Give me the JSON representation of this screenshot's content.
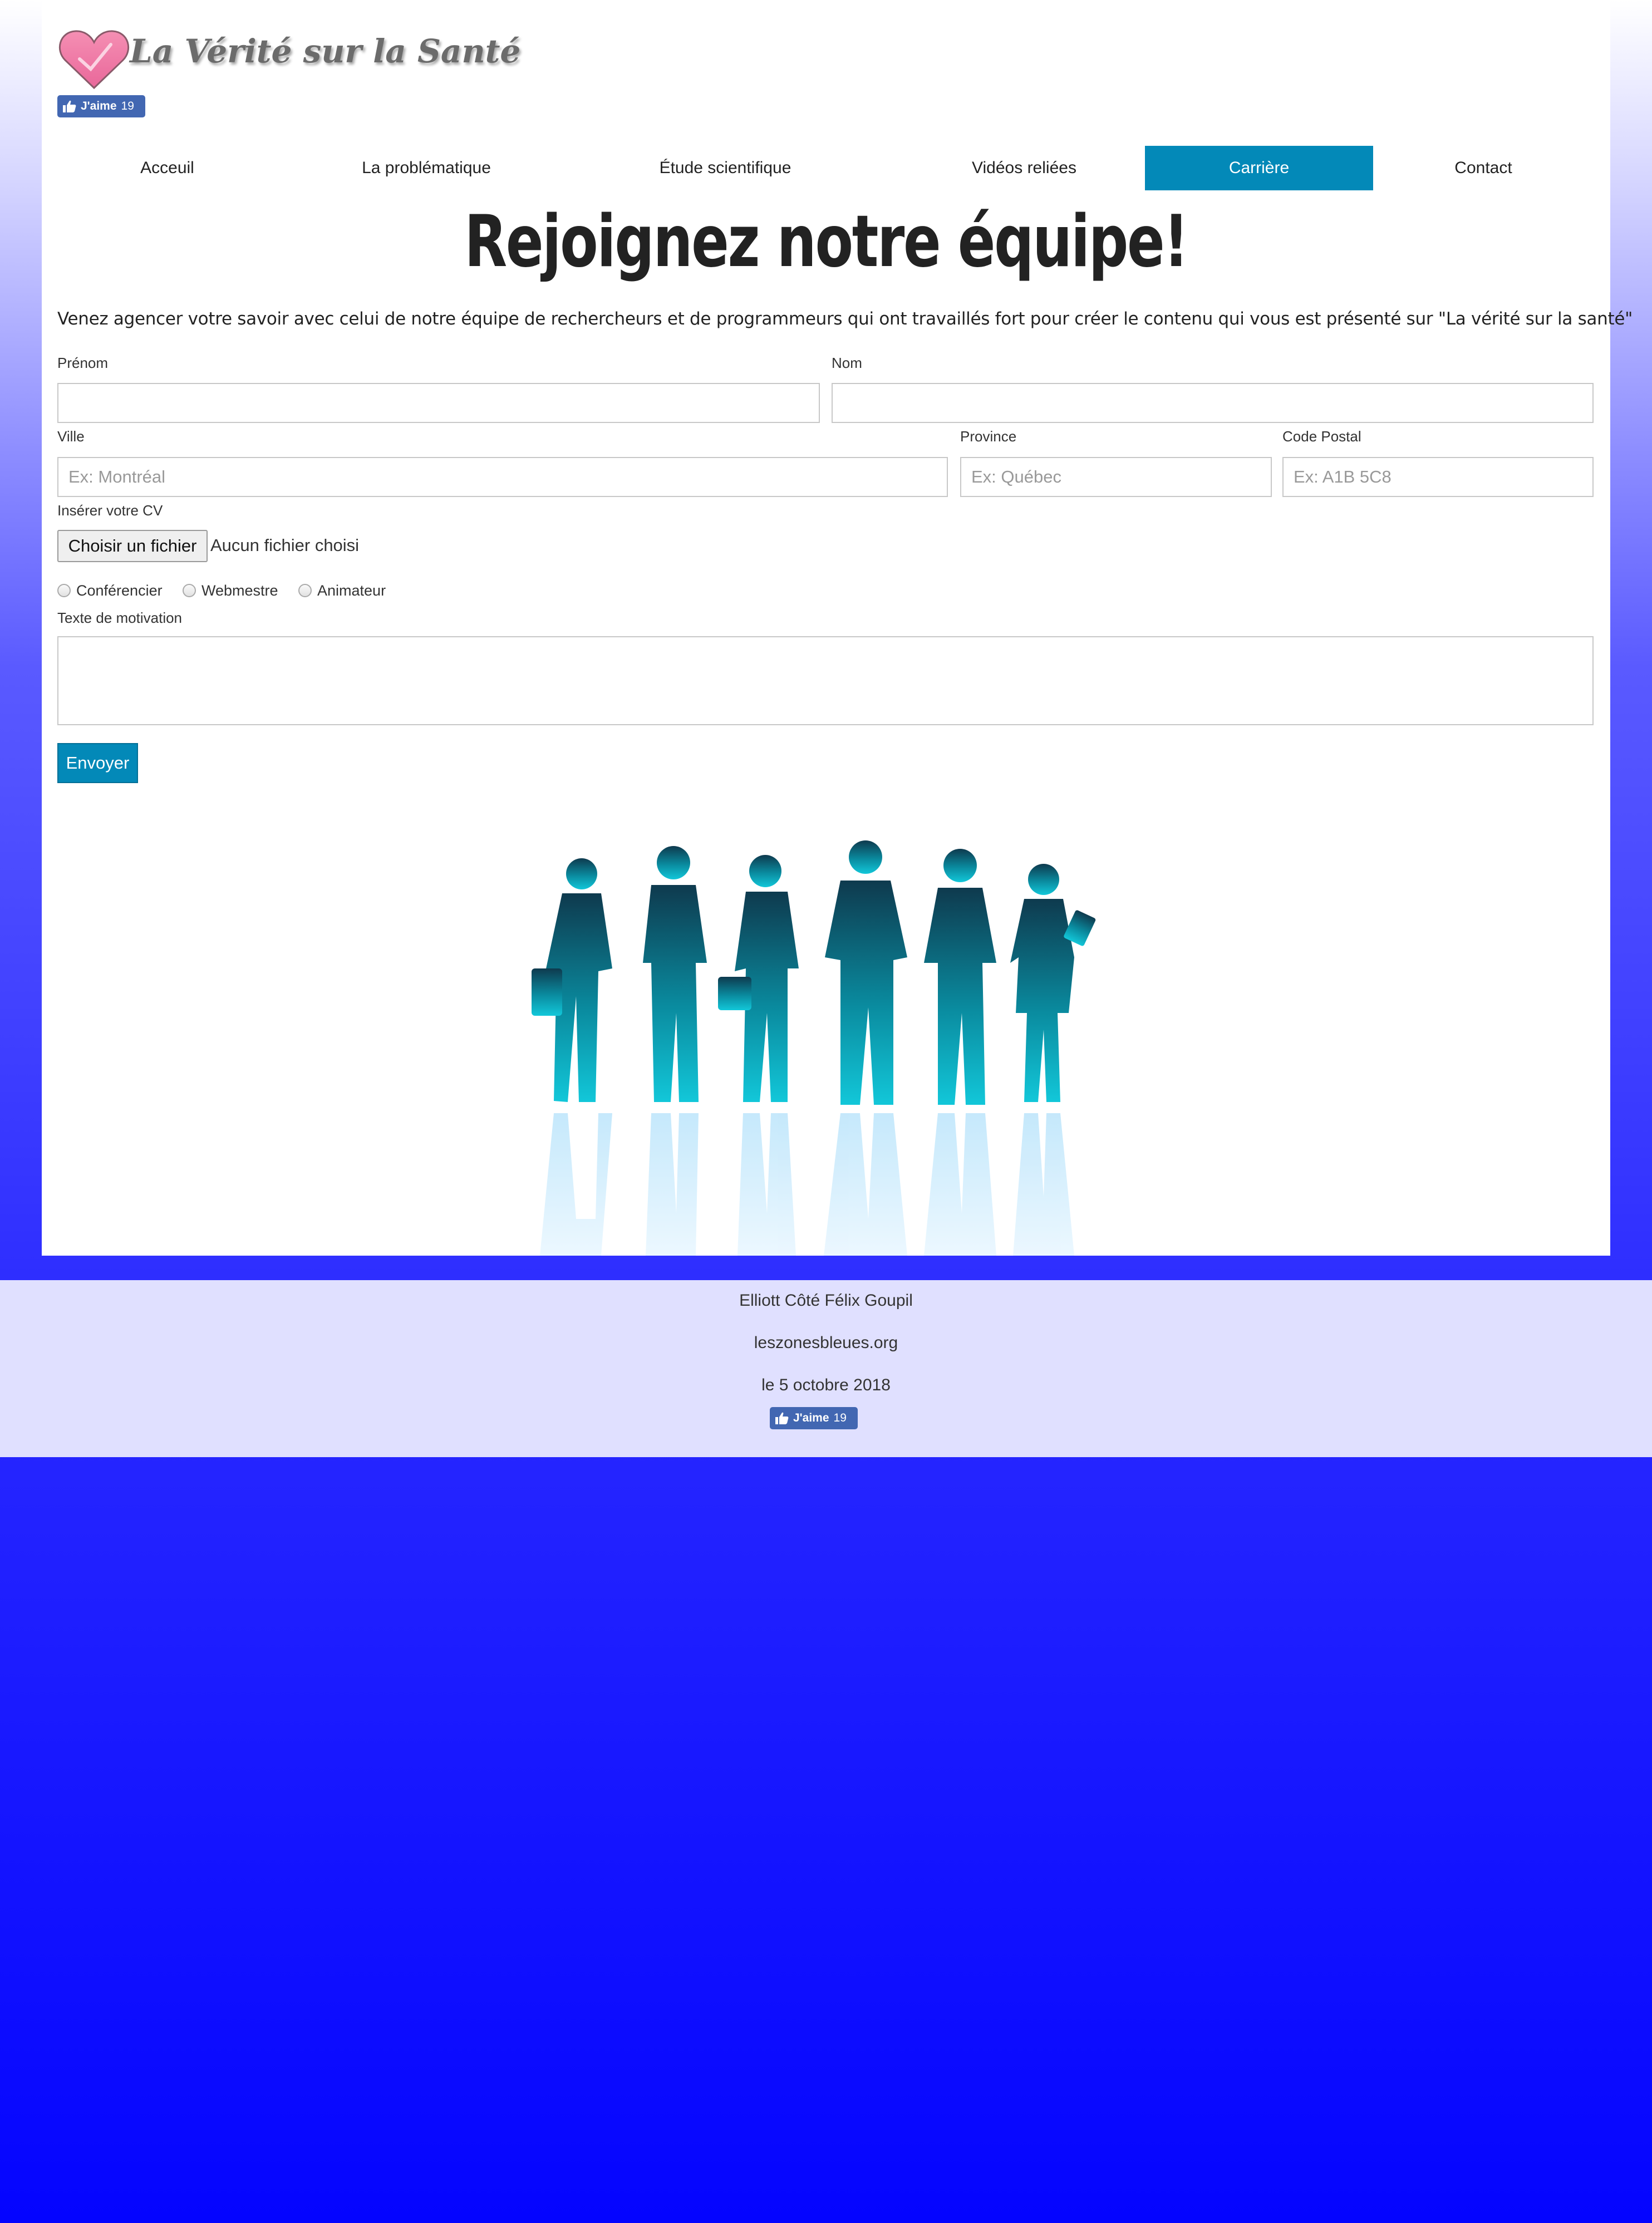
{
  "header": {
    "logo_text": "La Vérité sur la Santé",
    "like_label": "J'aime",
    "like_count": "19"
  },
  "nav": {
    "items": [
      {
        "label": "Acceuil"
      },
      {
        "label": "La problématique"
      },
      {
        "label": "Étude scientifique"
      },
      {
        "label": "Vidéos reliées"
      },
      {
        "label": "Carrière",
        "active": true
      },
      {
        "label": "Contact"
      }
    ]
  },
  "main": {
    "title": "Rejoignez notre équipe!",
    "intro": "Venez agencer votre savoir avec celui de notre équipe de rechercheurs et de programmeurs qui ont travaillés fort pour créer le contenu qui vous est présenté sur \"La vérité sur la santé\""
  },
  "form": {
    "first_name": {
      "label": "Prénom",
      "value": "",
      "placeholder": ""
    },
    "last_name": {
      "label": "Nom",
      "value": "",
      "placeholder": ""
    },
    "city": {
      "label": "Ville",
      "value": "",
      "placeholder": "Ex: Montréal"
    },
    "province": {
      "label": "Province",
      "value": "",
      "placeholder": "Ex: Québec"
    },
    "postal_code": {
      "label": "Code Postal",
      "value": "",
      "placeholder": "Ex: A1B 5C8"
    },
    "cv": {
      "label": "Insérer votre CV",
      "button": "Choisir un fichier",
      "status": "Aucun fichier choisi"
    },
    "roles": [
      {
        "label": "Conférencier",
        "checked": false
      },
      {
        "label": "Webmestre",
        "checked": false
      },
      {
        "label": "Animateur",
        "checked": false
      }
    ],
    "motivation": {
      "label": "Texte de motivation",
      "value": ""
    },
    "submit_label": "Envoyer"
  },
  "footer": {
    "authors": "Elliott Côté Félix Goupil",
    "site": "leszonesbleues.org",
    "date": "le 5 octobre 2018",
    "like_label": "J'aime",
    "like_count": "19"
  },
  "colors": {
    "accent": "#0389b8",
    "facebook": "#4267b2",
    "footer_bg": "#e0e0ff",
    "background_bottom": "#0404ff"
  }
}
